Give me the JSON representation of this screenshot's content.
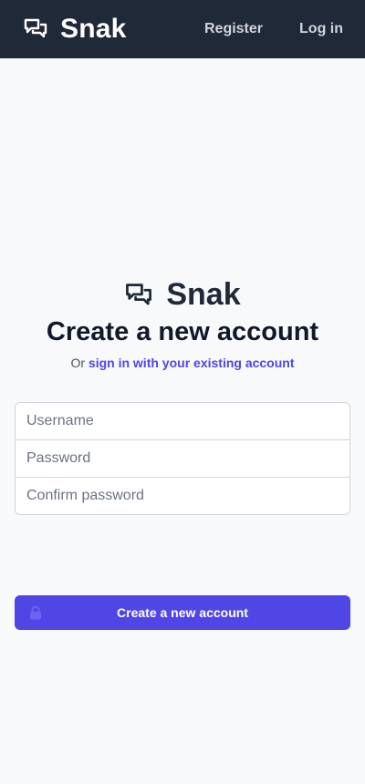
{
  "app": {
    "name": "Snak"
  },
  "nav": {
    "register_label": "Register",
    "login_label": "Log in"
  },
  "page": {
    "title": "Create a new account",
    "subtitle_prefix": "Or",
    "signin_link": "sign in with your existing account"
  },
  "form": {
    "username_placeholder": "Username",
    "password_placeholder": "Password",
    "confirm_placeholder": "Confirm password",
    "submit_label": "Create a new account"
  },
  "icons": {
    "logo": "chat-bubbles-icon",
    "submit": "lock-icon"
  },
  "colors": {
    "navbar": "#1f2937",
    "background": "#f8f9fb",
    "accent": "#4f46e5"
  }
}
